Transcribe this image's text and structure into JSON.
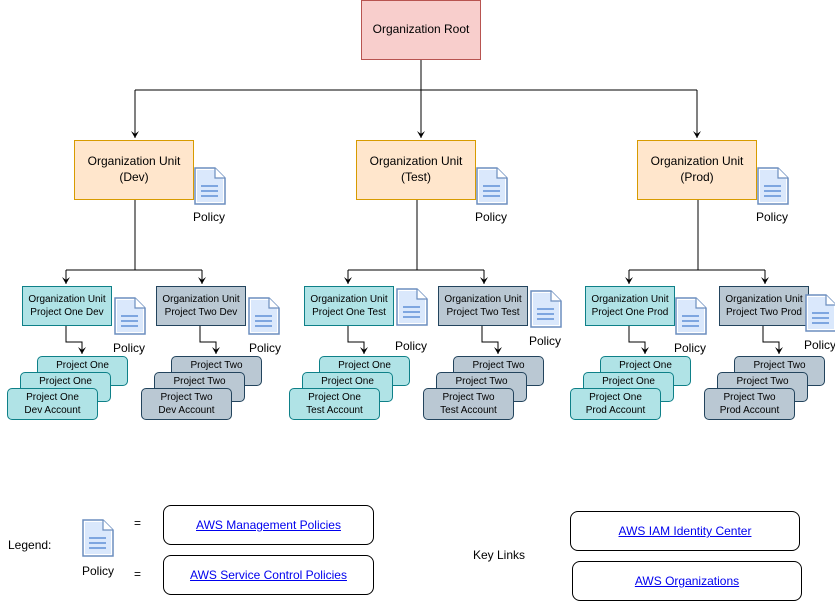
{
  "root": {
    "label": "Organization Root"
  },
  "policy_label": "Policy",
  "ous": [
    {
      "label": "Organization Unit",
      "env": "(Dev)",
      "subs": [
        {
          "line1": "Organization Unit",
          "line2": "Project One Dev",
          "style": "teal",
          "acct_back": "Project One",
          "acct_mid": "Project One",
          "acct_front1": "Project One",
          "acct_front2": "Dev Account"
        },
        {
          "line1": "Organization Unit",
          "line2": "Project Two Dev",
          "style": "grey",
          "acct_back": "Project Two",
          "acct_mid": "Project Two",
          "acct_front1": "Project Two",
          "acct_front2": "Dev Account"
        }
      ]
    },
    {
      "label": "Organization Unit",
      "env": "(Test)",
      "subs": [
        {
          "line1": "Organization Unit",
          "line2": "Project One Test",
          "style": "teal",
          "acct_back": "Project One",
          "acct_mid": "Project One",
          "acct_front1": "Project One",
          "acct_front2": "Test Account"
        },
        {
          "line1": "Organization Unit",
          "line2": "Project Two Test",
          "style": "grey",
          "acct_back": "Project Two",
          "acct_mid": "Project Two",
          "acct_front1": "Project Two",
          "acct_front2": "Test Account"
        }
      ]
    },
    {
      "label": "Organization Unit",
      "env": "(Prod)",
      "subs": [
        {
          "line1": "Organization Unit",
          "line2": "Project One Prod",
          "style": "teal",
          "acct_back": "Project One",
          "acct_mid": "Project One",
          "acct_front1": "Project One",
          "acct_front2": "Prod Account"
        },
        {
          "line1": "Organization Unit",
          "line2": "Project Two Prod",
          "style": "grey",
          "acct_back": "Project Two",
          "acct_mid": "Project Two",
          "acct_front1": "Project Two",
          "acct_front2": "Prod Account"
        }
      ]
    }
  ],
  "legend": {
    "label": "Legend:",
    "policy_label": "Policy",
    "equals": "=",
    "links": [
      "AWS Management Policies",
      "AWS Service Control Policies"
    ]
  },
  "key_links": {
    "label": "Key Links",
    "links": [
      "AWS IAM Identity Center",
      "AWS Organizations"
    ]
  },
  "colors": {
    "root_fill": "#f8cecc",
    "ou_fill": "#ffe6cc",
    "teal_fill": "#b0e3e6",
    "grey_fill": "#bac8d3",
    "policy_icon": "#6c8ebf",
    "link": "#0000ee"
  }
}
